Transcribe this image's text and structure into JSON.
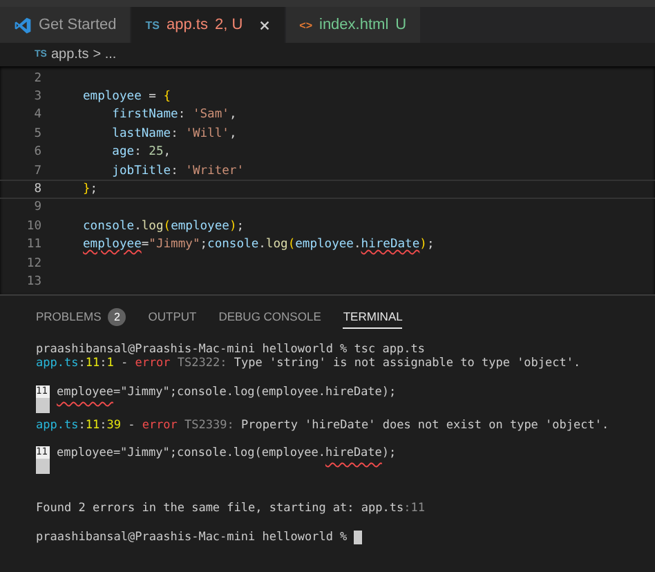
{
  "tabs": [
    {
      "kind": "welcome",
      "label": "Get Started",
      "selected": false
    },
    {
      "kind": "file",
      "badge": "TS",
      "label": "app.ts",
      "status": "2, U",
      "color": "#f48771",
      "selected": true
    },
    {
      "kind": "file",
      "badge": "<>",
      "label": "index.html",
      "status": "U",
      "color": "#73c991",
      "selected": false
    }
  ],
  "breadcrumb": {
    "badge": "TS",
    "file": "app.ts",
    "rest": "> ..."
  },
  "editor": {
    "lines": [
      {
        "number": "2",
        "current": false
      },
      {
        "number": "3",
        "current": false,
        "tokens": [
          {
            "text": "employee",
            "kind": "var"
          },
          {
            "text": " = ",
            "kind": "plain"
          },
          {
            "text": "{",
            "kind": "brace"
          }
        ]
      },
      {
        "number": "4",
        "current": false,
        "tokens": [
          {
            "text": "    firstName",
            "kind": "var"
          },
          {
            "text": ": ",
            "kind": "plain"
          },
          {
            "text": "'Sam'",
            "kind": "string"
          },
          {
            "text": ",",
            "kind": "plain"
          }
        ]
      },
      {
        "number": "5",
        "current": false,
        "tokens": [
          {
            "text": "    lastName",
            "kind": "var"
          },
          {
            "text": ": ",
            "kind": "plain"
          },
          {
            "text": "'Will'",
            "kind": "string"
          },
          {
            "text": ",",
            "kind": "plain"
          }
        ]
      },
      {
        "number": "6",
        "current": false,
        "tokens": [
          {
            "text": "    age",
            "kind": "var"
          },
          {
            "text": ": ",
            "kind": "plain"
          },
          {
            "text": "25",
            "kind": "number"
          },
          {
            "text": ",",
            "kind": "plain"
          }
        ]
      },
      {
        "number": "7",
        "current": false,
        "tokens": [
          {
            "text": "    jobTitle",
            "kind": "var"
          },
          {
            "text": ": ",
            "kind": "plain"
          },
          {
            "text": "'Writer'",
            "kind": "string"
          }
        ]
      },
      {
        "number": "8",
        "current": true,
        "tokens": [
          {
            "text": "}",
            "kind": "brace"
          },
          {
            "text": ";",
            "kind": "plain"
          }
        ]
      },
      {
        "number": "9",
        "current": false
      },
      {
        "number": "10",
        "current": false,
        "tokens": [
          {
            "text": "console",
            "kind": "var"
          },
          {
            "text": ".",
            "kind": "plain"
          },
          {
            "text": "log",
            "kind": "func"
          },
          {
            "text": "(",
            "kind": "brace"
          },
          {
            "text": "employee",
            "kind": "var"
          },
          {
            "text": ")",
            "kind": "brace"
          },
          {
            "text": ";",
            "kind": "plain"
          }
        ]
      },
      {
        "number": "11",
        "current": false,
        "tokens": [
          {
            "text": "employee",
            "kind": "var",
            "error": true
          },
          {
            "text": "=",
            "kind": "plain"
          },
          {
            "text": "\"Jimmy\"",
            "kind": "string"
          },
          {
            "text": ";",
            "kind": "plain"
          },
          {
            "text": "console",
            "kind": "var"
          },
          {
            "text": ".",
            "kind": "plain"
          },
          {
            "text": "log",
            "kind": "func"
          },
          {
            "text": "(",
            "kind": "brace"
          },
          {
            "text": "employee",
            "kind": "var"
          },
          {
            "text": ".",
            "kind": "plain"
          },
          {
            "text": "hireDate",
            "kind": "var",
            "error": true
          },
          {
            "text": ")",
            "kind": "brace"
          },
          {
            "text": ";",
            "kind": "plain"
          }
        ]
      },
      {
        "number": "12",
        "current": false
      },
      {
        "number": "13",
        "current": false
      }
    ]
  },
  "panel": {
    "tabs": [
      {
        "label": "PROBLEMS",
        "count": "2",
        "selected": false
      },
      {
        "label": "OUTPUT",
        "selected": false
      },
      {
        "label": "DEBUG CONSOLE",
        "selected": false
      },
      {
        "label": "TERMINAL",
        "selected": true
      }
    ],
    "terminal": [
      {
        "kind": "prompt",
        "segments": [
          {
            "text": "praashibansal@Praashis-Mac-mini helloworld % tsc app.ts",
            "kind": "plain"
          }
        ]
      },
      {
        "kind": "message",
        "segments": [
          {
            "text": "app.ts",
            "kind": "file"
          },
          {
            "text": ":",
            "kind": "plain"
          },
          {
            "text": "11",
            "kind": "loc"
          },
          {
            "text": ":",
            "kind": "plain"
          },
          {
            "text": "1",
            "kind": "loc"
          },
          {
            "text": " - ",
            "kind": "plain"
          },
          {
            "text": "error",
            "kind": "error"
          },
          {
            "text": " TS2322:",
            "kind": "code"
          },
          {
            "text": " Type 'string' is not assignable to type 'object'.",
            "kind": "plain"
          }
        ]
      },
      {
        "kind": "snippet",
        "gutter": "11",
        "segments": [
          {
            "text": "employee",
            "kind": "plain",
            "error": true
          },
          {
            "text": "=\"Jimmy\";console.log(employee.hireDate);",
            "kind": "plain"
          }
        ]
      },
      {
        "kind": "message",
        "segments": [
          {
            "text": "app.ts",
            "kind": "file"
          },
          {
            "text": ":",
            "kind": "plain"
          },
          {
            "text": "11",
            "kind": "loc"
          },
          {
            "text": ":",
            "kind": "plain"
          },
          {
            "text": "39",
            "kind": "loc"
          },
          {
            "text": " - ",
            "kind": "plain"
          },
          {
            "text": "error",
            "kind": "error"
          },
          {
            "text": " TS2339:",
            "kind": "code"
          },
          {
            "text": " Property 'hireDate' does not exist on type 'object'.",
            "kind": "plain"
          }
        ]
      },
      {
        "kind": "snippet",
        "gutter": "11",
        "segments": [
          {
            "text": "employee=\"Jimmy\";console.log(employee.",
            "kind": "plain"
          },
          {
            "text": "hireDate",
            "kind": "plain",
            "error": true
          },
          {
            "text": ");",
            "kind": "plain"
          }
        ]
      },
      {
        "kind": "summary",
        "segments": [
          {
            "text": "Found 2 errors in the same file, starting at: app.ts",
            "kind": "plain"
          },
          {
            "text": ":11",
            "kind": "code"
          }
        ]
      },
      {
        "kind": "prompt",
        "cursor": true,
        "segments": [
          {
            "text": "praashibansal@Praashis-Mac-mini helloworld % ",
            "kind": "plain"
          }
        ]
      }
    ]
  }
}
